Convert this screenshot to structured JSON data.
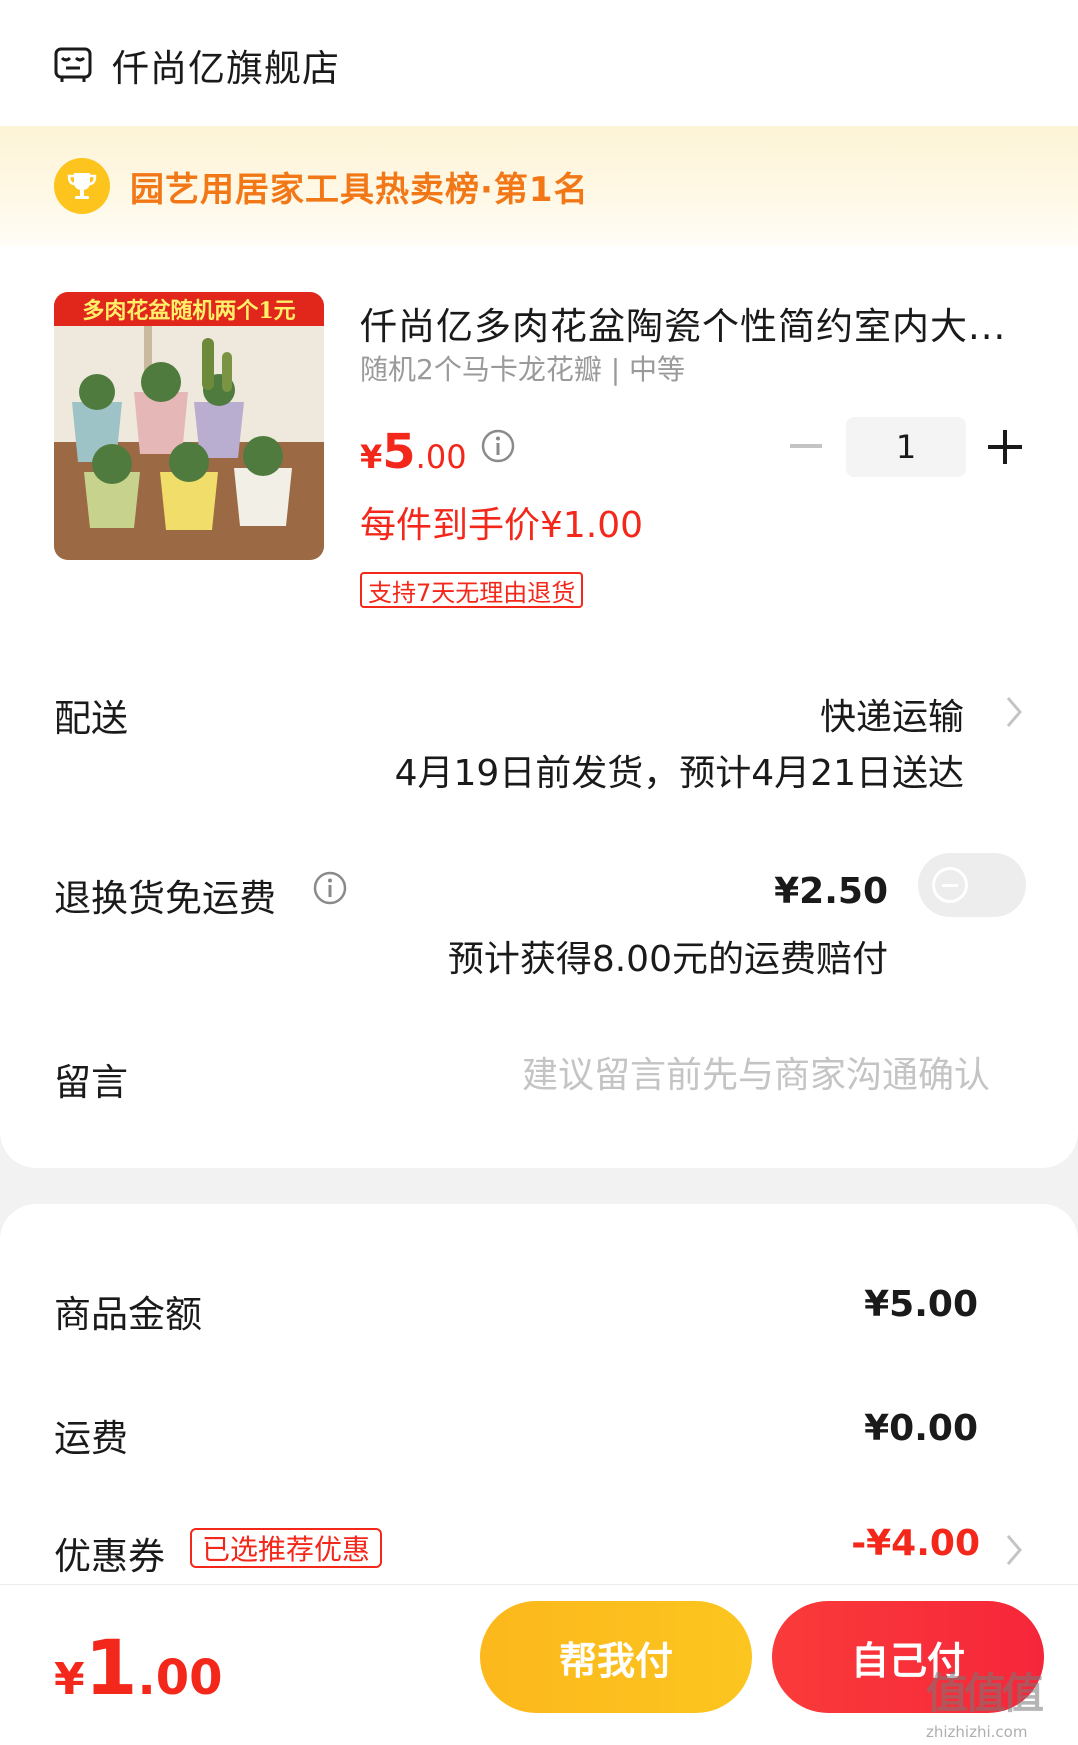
{
  "store": {
    "name": "仟尚亿旗舰店",
    "icon": "store-icon"
  },
  "rank_banner": {
    "text": "园艺用居家工具热卖榜·第1名",
    "icon": "trophy-icon"
  },
  "product": {
    "image_banner": "多肉花盆随机两个1元",
    "title": "仟尚亿多肉花盆陶瓷个性简约室内大...",
    "spec": "随机2个马卡龙花瓣 | 中等",
    "price_symbol": "¥",
    "price_int": "5",
    "price_dec": ".00",
    "unit_price": "每件到手价¥1.00",
    "return_badge": "支持7天无理由退货",
    "quantity": "1"
  },
  "delivery": {
    "label": "配送",
    "method": "快递运输",
    "date_text": "4月19日前发货，预计4月21日送达"
  },
  "return_shipping": {
    "label": "退换货免运费",
    "fee": "¥2.50",
    "note": "预计获得8.00元的运费赔付",
    "enabled": false
  },
  "message": {
    "label": "留言",
    "placeholder": "建议留言前先与商家沟通确认"
  },
  "summary": {
    "goods_label": "商品金额",
    "goods_value": "¥5.00",
    "shipping_label": "运费",
    "shipping_value": "¥0.00",
    "coupon_label": "优惠券",
    "coupon_badge": "已选推荐优惠",
    "coupon_value": "-¥4.00"
  },
  "bottom": {
    "total_symbol": "¥",
    "total_int": "1",
    "total_dec": ".00",
    "help_pay": "帮我付",
    "self_pay": "自己付"
  },
  "watermark": {
    "main": "值值值",
    "sub": "zhizhizhi.com"
  },
  "colors": {
    "accent_red": "#f3271a",
    "banner_orange": "#f27716",
    "trophy_yellow": "#fcc41c",
    "help_button": "#fcb81c",
    "self_button": "#f6263a"
  }
}
